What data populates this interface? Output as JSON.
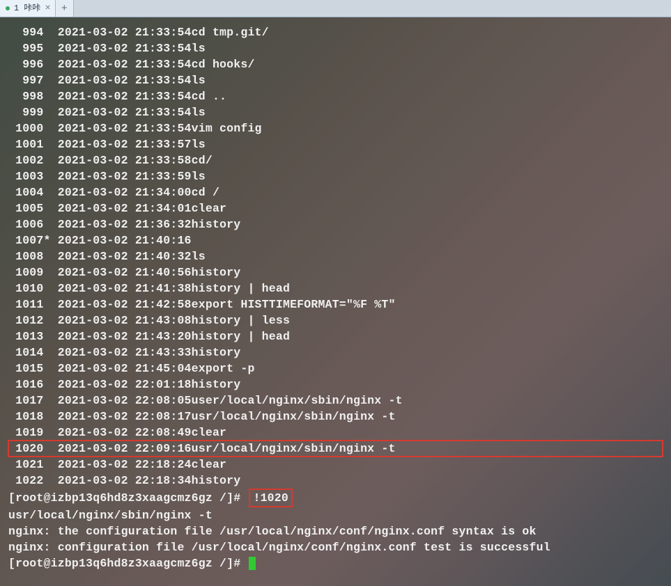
{
  "tabbar": {
    "tab_label": "1 咔咔",
    "close_glyph": "×",
    "newtab_glyph": "+"
  },
  "history": [
    {
      "num": "994",
      "mark": " ",
      "date": "2021-03-02",
      "time": "21:33:54",
      "cmd": "cd tmp.git/"
    },
    {
      "num": "995",
      "mark": " ",
      "date": "2021-03-02",
      "time": "21:33:54",
      "cmd": "ls"
    },
    {
      "num": "996",
      "mark": " ",
      "date": "2021-03-02",
      "time": "21:33:54",
      "cmd": "cd hooks/"
    },
    {
      "num": "997",
      "mark": " ",
      "date": "2021-03-02",
      "time": "21:33:54",
      "cmd": "ls"
    },
    {
      "num": "998",
      "mark": " ",
      "date": "2021-03-02",
      "time": "21:33:54",
      "cmd": "cd .."
    },
    {
      "num": "999",
      "mark": " ",
      "date": "2021-03-02",
      "time": "21:33:54",
      "cmd": "ls"
    },
    {
      "num": "1000",
      "mark": " ",
      "date": "2021-03-02",
      "time": "21:33:54",
      "cmd": "vim config"
    },
    {
      "num": "1001",
      "mark": " ",
      "date": "2021-03-02",
      "time": "21:33:57",
      "cmd": "ls"
    },
    {
      "num": "1002",
      "mark": " ",
      "date": "2021-03-02",
      "time": "21:33:58",
      "cmd": "cd/"
    },
    {
      "num": "1003",
      "mark": " ",
      "date": "2021-03-02",
      "time": "21:33:59",
      "cmd": "ls"
    },
    {
      "num": "1004",
      "mark": " ",
      "date": "2021-03-02",
      "time": "21:34:00",
      "cmd": "cd /"
    },
    {
      "num": "1005",
      "mark": " ",
      "date": "2021-03-02",
      "time": "21:34:01",
      "cmd": "clear"
    },
    {
      "num": "1006",
      "mark": " ",
      "date": "2021-03-02",
      "time": "21:36:32",
      "cmd": "history"
    },
    {
      "num": "1007",
      "mark": "*",
      "date": "2021-03-02",
      "time": "21:40:16",
      "cmd": ""
    },
    {
      "num": "1008",
      "mark": " ",
      "date": "2021-03-02",
      "time": "21:40:32",
      "cmd": "ls"
    },
    {
      "num": "1009",
      "mark": " ",
      "date": "2021-03-02",
      "time": "21:40:56",
      "cmd": "history"
    },
    {
      "num": "1010",
      "mark": " ",
      "date": "2021-03-02",
      "time": "21:41:38",
      "cmd": "history | head"
    },
    {
      "num": "1011",
      "mark": " ",
      "date": "2021-03-02",
      "time": "21:42:58",
      "cmd": "export HISTTIMEFORMAT=\"%F %T\""
    },
    {
      "num": "1012",
      "mark": " ",
      "date": "2021-03-02",
      "time": "21:43:08",
      "cmd": "history | less"
    },
    {
      "num": "1013",
      "mark": " ",
      "date": "2021-03-02",
      "time": "21:43:20",
      "cmd": "history | head"
    },
    {
      "num": "1014",
      "mark": " ",
      "date": "2021-03-02",
      "time": "21:43:33",
      "cmd": "history"
    },
    {
      "num": "1015",
      "mark": " ",
      "date": "2021-03-02",
      "time": "21:45:04",
      "cmd": "export -p"
    },
    {
      "num": "1016",
      "mark": " ",
      "date": "2021-03-02",
      "time": "22:01:18",
      "cmd": "history"
    },
    {
      "num": "1017",
      "mark": " ",
      "date": "2021-03-02",
      "time": "22:08:05",
      "cmd": "user/local/nginx/sbin/nginx -t"
    },
    {
      "num": "1018",
      "mark": " ",
      "date": "2021-03-02",
      "time": "22:08:17",
      "cmd": "usr/local/nginx/sbin/nginx -t"
    },
    {
      "num": "1019",
      "mark": " ",
      "date": "2021-03-02",
      "time": "22:08:49",
      "cmd": "clear"
    },
    {
      "num": "1020",
      "mark": " ",
      "date": "2021-03-02",
      "time": "22:09:16",
      "cmd": "usr/local/nginx/sbin/nginx -t",
      "highlight": true
    },
    {
      "num": "1021",
      "mark": " ",
      "date": "2021-03-02",
      "time": "22:18:24",
      "cmd": "clear"
    },
    {
      "num": "1022",
      "mark": " ",
      "date": "2021-03-02",
      "time": "22:18:34",
      "cmd": "history"
    }
  ],
  "prompt1": {
    "text": "[root@izbp13q6hd8z3xaagcmz6gz /]# ",
    "typed": "!1020",
    "typed_highlight": true
  },
  "output": [
    "usr/local/nginx/sbin/nginx -t",
    "nginx: the configuration file /usr/local/nginx/conf/nginx.conf syntax is ok",
    "nginx: configuration file /usr/local/nginx/conf/nginx.conf test is successful"
  ],
  "prompt2": {
    "text": "[root@izbp13q6hd8z3xaagcmz6gz /]# "
  }
}
